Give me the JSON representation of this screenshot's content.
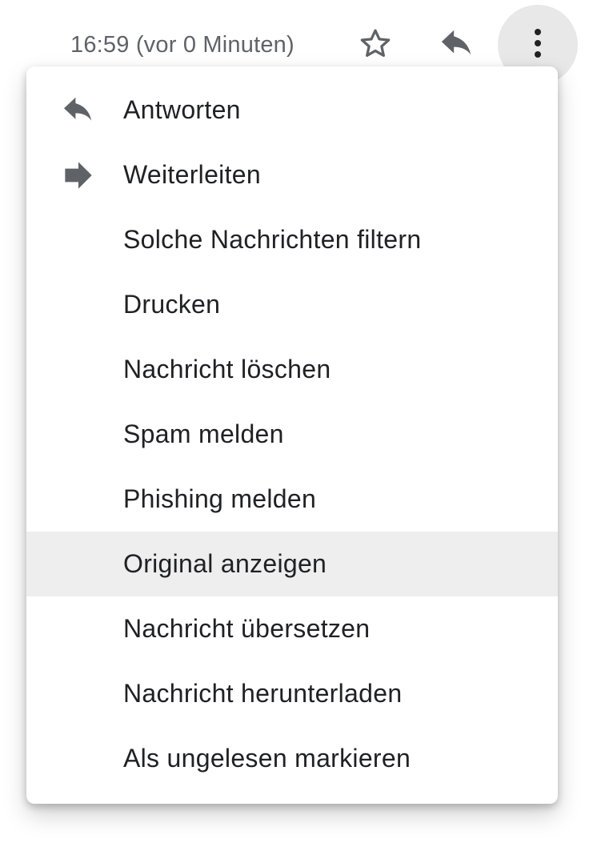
{
  "header": {
    "timestamp": "16:59 (vor 0 Minuten)",
    "icons": {
      "star": "star-outline-icon",
      "reply": "reply-icon",
      "more": "more-vertical-icon"
    }
  },
  "menu": {
    "items": [
      {
        "label": "Antworten",
        "icon": "reply-icon"
      },
      {
        "label": "Weiterleiten",
        "icon": "forward-icon"
      },
      {
        "label": "Solche Nachrichten filtern"
      },
      {
        "label": "Drucken"
      },
      {
        "label": "Nachricht löschen"
      },
      {
        "label": "Spam melden"
      },
      {
        "label": "Phishing melden"
      },
      {
        "label": "Original anzeigen",
        "highlighted": true
      },
      {
        "label": "Nachricht übersetzen"
      },
      {
        "label": "Nachricht herunterladen"
      },
      {
        "label": "Als ungelesen markieren"
      }
    ]
  },
  "colors": {
    "text_primary": "#202124",
    "text_secondary": "#5f6368",
    "icon_gray": "#5f6368",
    "hover_bg": "#eeeeee",
    "more_button_bg": "#e8e8e8"
  }
}
